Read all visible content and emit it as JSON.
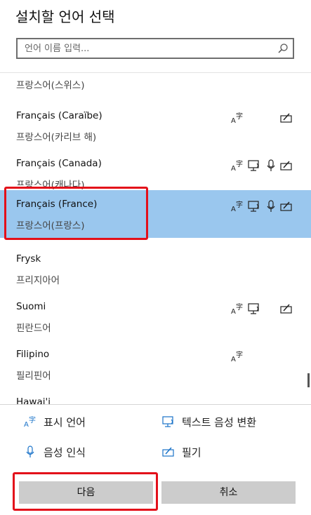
{
  "header": {
    "title": "설치할 언어 선택"
  },
  "search": {
    "placeholder": "언어 이름 입력..."
  },
  "languages": [
    {
      "name": "",
      "sub": "프랑스어(스위스)",
      "features": []
    },
    {
      "name": "Français (Caraïbe)",
      "sub": "프랑스어(카리브 해)",
      "features": [
        "display",
        "handwriting"
      ]
    },
    {
      "name": "Français (Canada)",
      "sub": "프랑스어(캐나다)",
      "features": [
        "display",
        "tts",
        "speech",
        "handwriting"
      ]
    },
    {
      "name": "Français (France)",
      "sub": "프랑스어(프랑스)",
      "features": [
        "display",
        "tts",
        "speech",
        "handwriting"
      ],
      "selected": true
    },
    {
      "name": "Frysk",
      "sub": "프리지아어",
      "features": []
    },
    {
      "name": "Suomi",
      "sub": "핀란드어",
      "features": [
        "display",
        "tts",
        "handwriting"
      ]
    },
    {
      "name": "Filipino",
      "sub": "필리핀어",
      "features": [
        "display"
      ]
    },
    {
      "name": "Hawai'i",
      "sub": "",
      "features": []
    }
  ],
  "legend": {
    "display": "표시 언어",
    "tts": "텍스트 음성 변환",
    "speech": "음성 인식",
    "handwriting": "필기"
  },
  "buttons": {
    "next": "다음",
    "cancel": "취소"
  },
  "colors": {
    "selected_bg": "#9ac7ee",
    "highlight_box": "#e3101a",
    "button_bg": "#cccccc",
    "icon_blue": "#1a73c9"
  }
}
